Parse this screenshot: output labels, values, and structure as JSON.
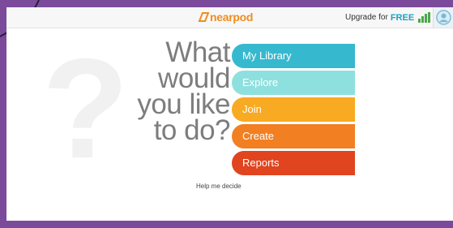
{
  "app": {
    "logo_text": "nearpod"
  },
  "header": {
    "upgrade_label": "Upgrade for",
    "upgrade_free": "FREE",
    "signal_icon": "signal-bars-icon",
    "avatar_icon": "user-avatar-icon"
  },
  "main": {
    "background_icon": "question-mark-icon",
    "background_glyph": "?",
    "prompt_lines": [
      "What",
      "would",
      "you like",
      "to do?"
    ],
    "menu": [
      {
        "label": "My Library",
        "color": "#36b9ce"
      },
      {
        "label": "Explore",
        "color": "#8ee0df"
      },
      {
        "label": "Join",
        "color": "#f8aa22"
      },
      {
        "label": "Create",
        "color": "#f27f22"
      },
      {
        "label": "Reports",
        "color": "#e0451f"
      }
    ],
    "help_link": "Help me decide"
  },
  "colors": {
    "frame": "#7b4a9a",
    "brand_orange": "#f08d1f",
    "free_blue": "#1aa3c2",
    "signal_green": "#4aa84a",
    "prompt_gray": "#7d7d7d"
  }
}
